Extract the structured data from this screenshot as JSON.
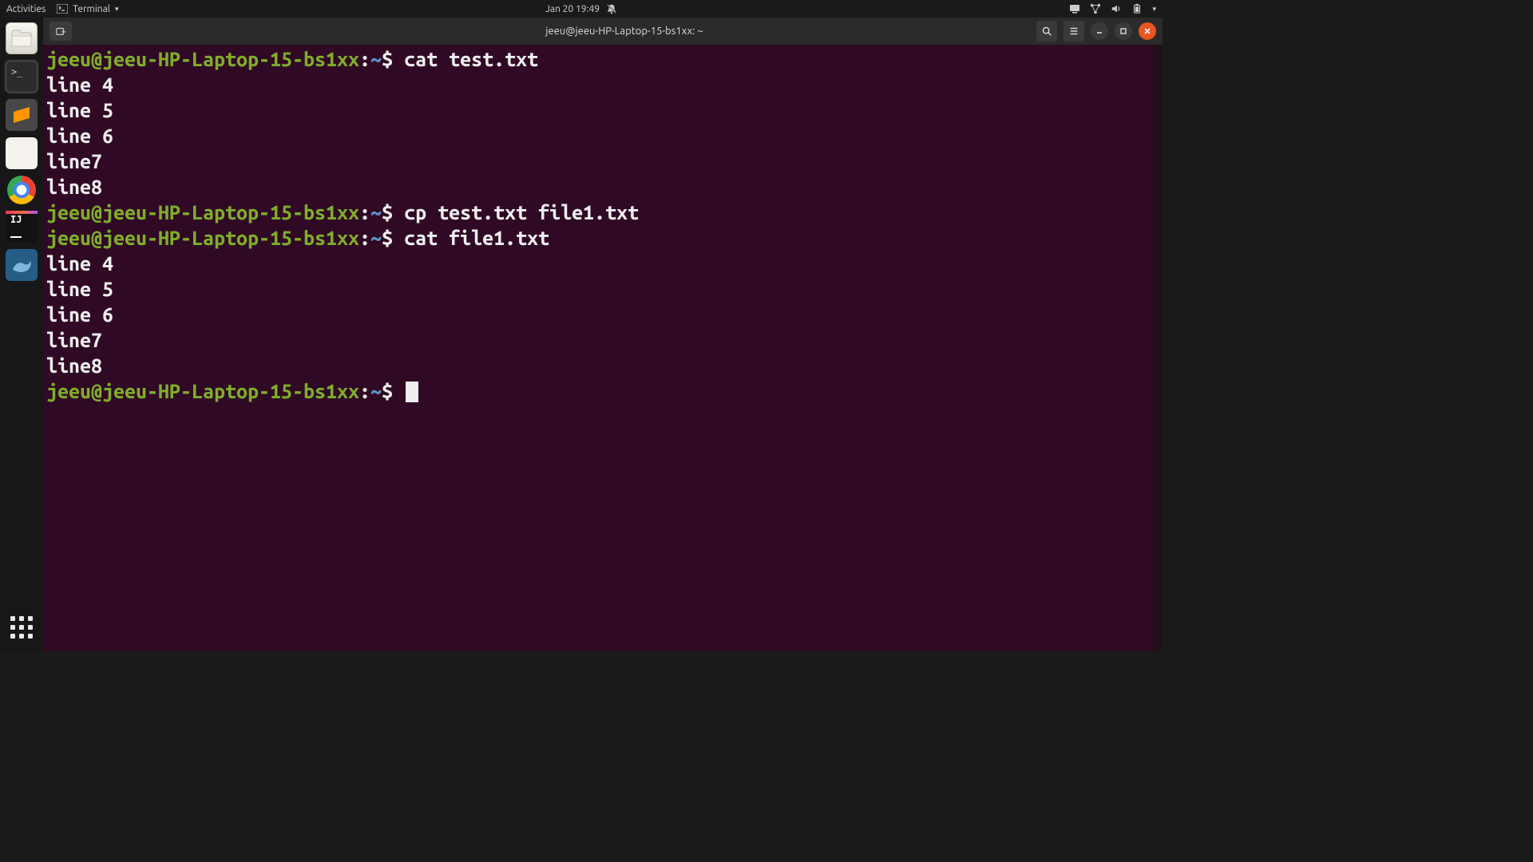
{
  "topbar": {
    "activities": "Activities",
    "app_name": "Terminal",
    "datetime": "Jan 20  19:49"
  },
  "dock": {
    "items": [
      "files",
      "terminal",
      "sublime",
      "docviewer",
      "chrome",
      "intellij",
      "mysqlwb"
    ]
  },
  "window": {
    "title": "jeeu@jeeu-HP-Laptop-15-bs1xx: ~"
  },
  "prompt": {
    "userhost": "jeeu@jeeu-HP-Laptop-15-bs1xx",
    "sep": ":",
    "path": "~",
    "symbol": "$"
  },
  "session": [
    {
      "type": "cmd",
      "text": "cat test.txt"
    },
    {
      "type": "out",
      "text": "line 4"
    },
    {
      "type": "out",
      "text": "line 5"
    },
    {
      "type": "out",
      "text": "line 6"
    },
    {
      "type": "out",
      "text": "line7"
    },
    {
      "type": "out",
      "text": "line8"
    },
    {
      "type": "cmd",
      "text": "cp test.txt file1.txt"
    },
    {
      "type": "cmd",
      "text": "cat file1.txt"
    },
    {
      "type": "out",
      "text": "line 4"
    },
    {
      "type": "out",
      "text": "line 5"
    },
    {
      "type": "out",
      "text": "line 6"
    },
    {
      "type": "out",
      "text": "line7"
    },
    {
      "type": "out",
      "text": "line8"
    },
    {
      "type": "cmd",
      "text": "",
      "cursor": true
    }
  ]
}
